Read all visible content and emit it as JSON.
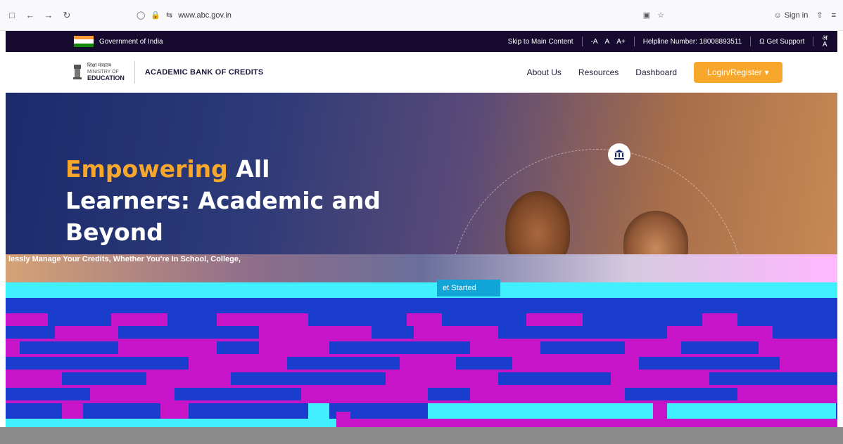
{
  "browser": {
    "url": "www.abc.gov.in",
    "signin_label": "Sign in"
  },
  "gov_strip": {
    "flag_colors": [
      "#ff9933",
      "#ffffff",
      "#138808"
    ],
    "gov_name": "Government of India",
    "skip_link": "Skip to Main Content",
    "font_small": "-A",
    "font_normal": "A",
    "font_large": "A+",
    "helpline": "Helpline Number: 18008893511",
    "support": "Get Support",
    "lang_top": "अ",
    "lang_bottom": "A"
  },
  "header": {
    "moe_hindi": "शिक्षा मंत्रालय",
    "moe_line1": "MINISTRY OF",
    "moe_line2": "EDUCATION",
    "abc_title": "ACADEMIC BANK OF CREDITS",
    "nav": [
      "About Us",
      "Resources",
      "Dashboard"
    ],
    "login_label": "Login/Register"
  },
  "hero": {
    "title_accent": "Empowering",
    "title_rest_1": " All",
    "title_line2": "Learners: Academic and",
    "title_line3": "Beyond",
    "subtitle_fragment": "lessly Manage Your Credits, Whether You're In School, College,",
    "cta_fragment": "et Started"
  },
  "colors": {
    "accent": "#f7a72b",
    "strip_bg": "#160b2e",
    "glitch_magenta": "#c814c8",
    "glitch_blue": "#1a3ccc",
    "glitch_cyan": "#40f0ff"
  }
}
